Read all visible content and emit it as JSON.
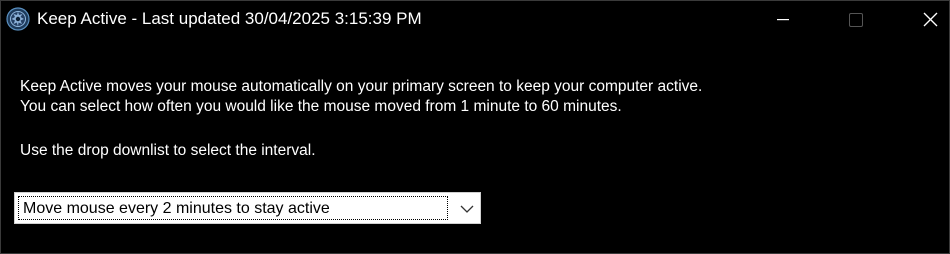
{
  "window": {
    "title": "Keep Active - Last updated 30/04/2025 3:15:39 PM",
    "app_icon": "keep-active-app-icon",
    "caption_buttons": {
      "minimize_icon": "minimize-icon",
      "maximize_icon": "maximize-icon",
      "close_icon": "close-icon"
    }
  },
  "content": {
    "description_line_1": "Keep Active moves your mouse automatically on your primary screen to keep your computer active.",
    "description_line_2": "You can select how often you would like the mouse moved from 1 minute to 60 minutes.",
    "instruction": "Use the drop downlist to select the interval.",
    "interval_select": {
      "selected_value": "Move mouse every 2 minutes to stay active",
      "icon": "chevron-down-icon"
    }
  },
  "colors": {
    "background": "#000000",
    "text": "#ffffff",
    "select_background": "#ffffff",
    "select_text": "#000000",
    "disabled_caption": "#555555"
  }
}
